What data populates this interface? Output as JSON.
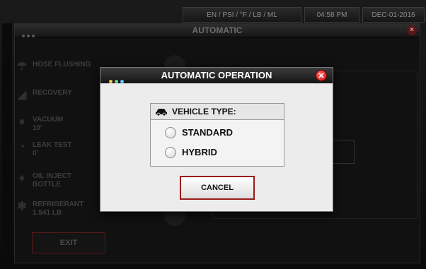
{
  "status_bar": {
    "units": "EN / PSI / °F / LB / ML",
    "time": "04:58 PM",
    "date": "DEC-01-2016"
  },
  "app": {
    "title": "AUTOMATIC",
    "menu": [
      {
        "label": "HOSE FLUSHING",
        "icon": "hose-icon"
      },
      {
        "label": "RECOVERY",
        "icon": "recovery-icon"
      },
      {
        "label": "VACUUM",
        "sub": "10'",
        "icon": "vacuum-icon"
      },
      {
        "label": "LEAK TEST",
        "sub": "0'",
        "icon": "leak-test-icon"
      },
      {
        "label": "OIL INJECT",
        "sub": "BOTTLE",
        "icon": "oil-icon"
      },
      {
        "label": "REFRIGERANT",
        "sub": "1.541 LB",
        "icon": "refrigerant-icon"
      }
    ],
    "exit_label": "EXIT"
  },
  "modal": {
    "title": "AUTOMATIC OPERATION",
    "section_label": "VEHICLE TYPE:",
    "options": [
      {
        "label": "STANDARD",
        "selected": false
      },
      {
        "label": "HYBRID",
        "selected": false
      }
    ],
    "cancel_label": "CANCEL",
    "dot_colors": [
      "#f2c94c",
      "#6fcf97",
      "#56ccf2"
    ],
    "close_color": "#e02020",
    "cancel_border_color": "#9b1b1b"
  }
}
